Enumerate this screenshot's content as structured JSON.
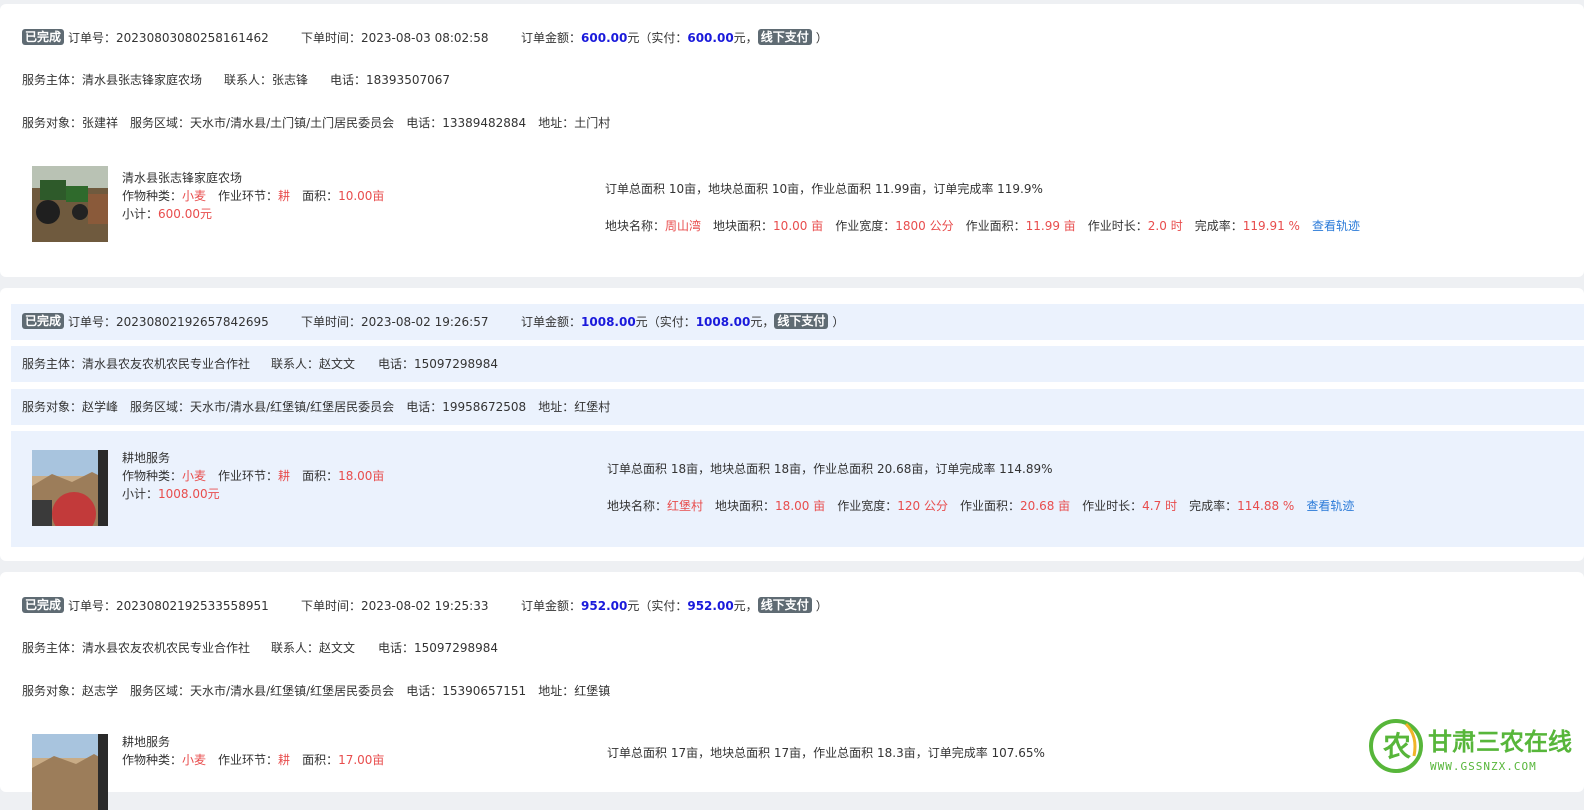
{
  "labels": {
    "order_no": "订单号：",
    "order_time": "下单时间：",
    "order_amount": "订单金额：",
    "paid_open": "（实付：",
    "yuan": "元",
    "yuan_comma": "元，",
    "paid_close": "）",
    "provider": "服务主体：",
    "contact": "联系人：",
    "phone": "电话：",
    "target": "服务对象：",
    "area": "服务区域：",
    "address": "地址：",
    "crop": "作物种类：",
    "stage": "作业环节：",
    "size": "面积：",
    "subtotal": "小计：",
    "plot_name": "地块名称：",
    "plot_area": "地块面积：",
    "work_width": "作业宽度：",
    "work_area": "作业面积：",
    "work_time": "作业时长：",
    "completion": "完成率：",
    "view_track": "查看轨迹"
  },
  "orders": [
    {
      "status": "已完成",
      "order_no": "20230803080258161462",
      "order_time": "2023-08-03 08:02:58",
      "amount": "600.00",
      "paid": "600.00",
      "pay_method": "线下支付",
      "provider": "清水县张志锋家庭农场",
      "contact": "张志锋",
      "provider_phone": "18393507067",
      "target": "张建祥",
      "area": "天水市/清水县/土门镇/土门居民委员会",
      "target_phone": "13389482884",
      "address": "土门村",
      "service_name": "清水县张志锋家庭农场",
      "crop": "小麦",
      "stage": "耕",
      "size": "10.00亩",
      "subtotal": "600.00元",
      "summary": "订单总面积 10亩，地块总面积 10亩，作业总面积 11.99亩，订单完成率 119.9%",
      "plot_name": "周山湾",
      "plot_area": "10.00 亩",
      "work_width": "1800 公分",
      "work_area": "11.99 亩",
      "work_time": "2.0 时",
      "completion": "119.91 %"
    },
    {
      "status": "已完成",
      "order_no": "20230802192657842695",
      "order_time": "2023-08-02 19:26:57",
      "amount": "1008.00",
      "paid": "1008.00",
      "pay_method": "线下支付",
      "provider": "清水县农友农机农民专业合作社",
      "contact": "赵文文",
      "provider_phone": "15097298984",
      "target": "赵学峰",
      "area": "天水市/清水县/红堡镇/红堡居民委员会",
      "target_phone": "19958672508",
      "address": "红堡村",
      "service_name": "耕地服务",
      "crop": "小麦",
      "stage": "耕",
      "size": "18.00亩",
      "subtotal": "1008.00元",
      "summary": "订单总面积 18亩，地块总面积 18亩，作业总面积 20.68亩，订单完成率 114.89%",
      "plot_name": "红堡村",
      "plot_area": "18.00 亩",
      "work_width": "120 公分",
      "work_area": "20.68 亩",
      "work_time": "4.7 时",
      "completion": "114.88 %"
    },
    {
      "status": "已完成",
      "order_no": "20230802192533558951",
      "order_time": "2023-08-02 19:25:33",
      "amount": "952.00",
      "paid": "952.00",
      "pay_method": "线下支付",
      "provider": "清水县农友农机农民专业合作社",
      "contact": "赵文文",
      "provider_phone": "15097298984",
      "target": "赵志学",
      "area": "天水市/清水县/红堡镇/红堡居民委员会",
      "target_phone": "15390657151",
      "address": "红堡镇",
      "service_name": "耕地服务",
      "crop": "小麦",
      "stage": "耕",
      "size": "17.00亩",
      "summary": "订单总面积 17亩，地块总面积 17亩，作业总面积 18.3亩，订单完成率 107.65%"
    }
  ],
  "watermark": {
    "logo_char": "农",
    "title": "甘肃三农在线",
    "url": "WWW.GSSNZX.COM"
  },
  "colors": {
    "price_blue": "#1a1adb",
    "value_red": "#e84d4d",
    "link_blue": "#2a7ad8",
    "badge_gray": "#5f6b73",
    "highlight_bg": "#ebf2fd",
    "logo_green": "#57b63a"
  }
}
